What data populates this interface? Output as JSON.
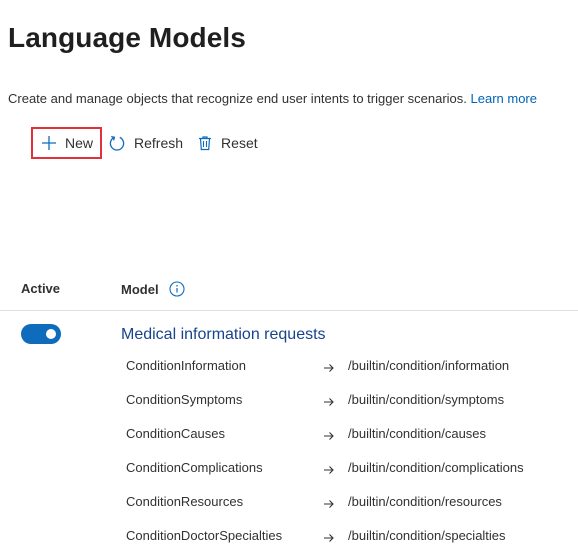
{
  "page": {
    "title": "Language Models",
    "description": "Create and manage objects that recognize end user intents to trigger scenarios.",
    "learn_more": "Learn more"
  },
  "toolbar": {
    "new_label": "New",
    "refresh_label": "Refresh",
    "reset_label": "Reset"
  },
  "table": {
    "col_active": "Active",
    "col_model": "Model"
  },
  "model": {
    "name": "Medical information requests",
    "active": true,
    "intents": [
      {
        "name": "ConditionInformation",
        "path": "/builtin/condition/information"
      },
      {
        "name": "ConditionSymptoms",
        "path": "/builtin/condition/symptoms"
      },
      {
        "name": "ConditionCauses",
        "path": "/builtin/condition/causes"
      },
      {
        "name": "ConditionComplications",
        "path": "/builtin/condition/complications"
      },
      {
        "name": "ConditionResources",
        "path": "/builtin/condition/resources"
      },
      {
        "name": "ConditionDoctorSpecialties",
        "path": "/builtin/condition/specialties"
      }
    ]
  },
  "colors": {
    "accent": "#0f6cbd",
    "link": "#0064b4",
    "highlight_border": "#e0323c"
  },
  "icons": {
    "new": "plus-icon",
    "refresh": "refresh-icon",
    "reset": "trash-icon",
    "info": "info-icon",
    "arrow": "arrow-right-icon"
  }
}
